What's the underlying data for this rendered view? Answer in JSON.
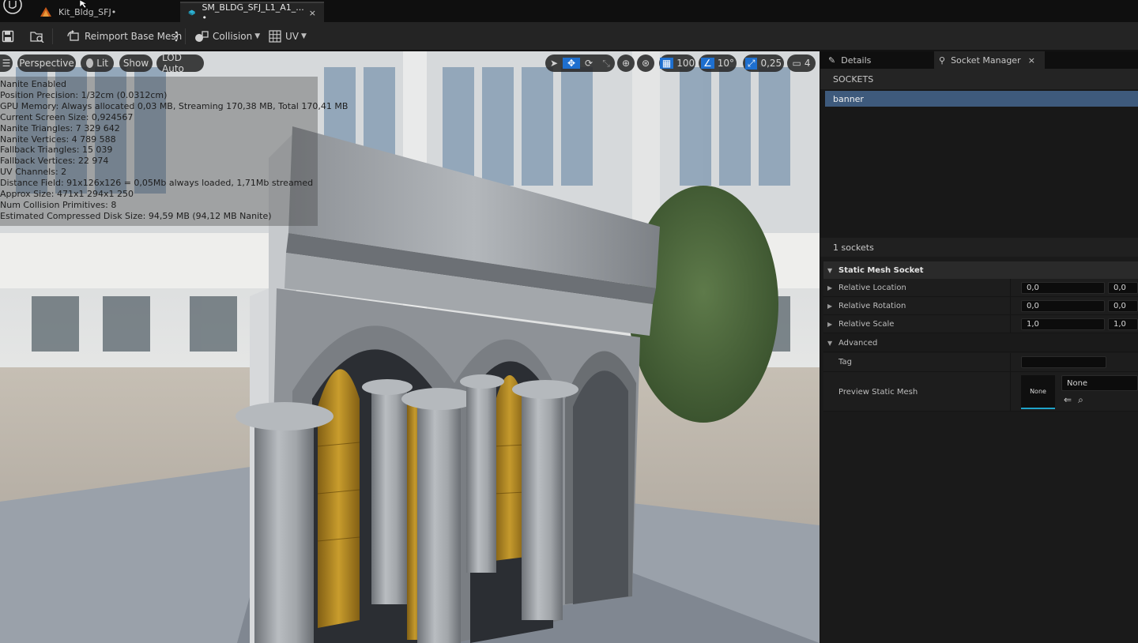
{
  "tabs": [
    {
      "label": "Kit_Bldg_SFJ•",
      "icon": "level-icon"
    },
    {
      "label": "SM_BLDG_SFJ_L1_A1_... •",
      "icon": "static-mesh-icon",
      "close": "×"
    }
  ],
  "toolbar": {
    "reimport_label": "Reimport Base Mesh",
    "collision_label": "Collision",
    "uv_label": "UV"
  },
  "viewport": {
    "perspective": "Perspective",
    "lit": "Lit",
    "show": "Show",
    "lod": "LOD Auto",
    "grid_snap": "100",
    "rotation_snap": "10°",
    "scale_snap": "0,25",
    "camera_speed": "4"
  },
  "stats": [
    "Nanite Enabled",
    "Position Precision: 1/32cm (0.0312cm)",
    "GPU Memory: Always allocated 0,03 MB, Streaming 170,38 MB, Total 170,41 MB",
    "Current Screen Size:  0,924567",
    "Nanite Triangles:  7 329 642",
    "Nanite Vertices:  4 789 588",
    "Fallback Triangles:  15 039",
    "Fallback Vertices:  22 974",
    "UV Channels:  2",
    "Distance Field:  91x126x126 = 0,05Mb always loaded, 1,71Mb streamed",
    "Approx Size: 471x1 294x1 250",
    "Num Collision Primitives:  8",
    "Estimated Compressed Disk Size: 94,59 MB (94,12 MB Nanite)"
  ],
  "panel": {
    "details_tab": "Details",
    "socket_tab": "Socket Manager",
    "close": "×",
    "sockets_header": "SOCKETS",
    "sockets": [
      "banner"
    ],
    "socket_count": "1 sockets",
    "section_title": "Static Mesh Socket",
    "props": {
      "relative_location": {
        "label": "Relative Location",
        "x": "0,0",
        "y": "0,0"
      },
      "relative_rotation": {
        "label": "Relative Rotation",
        "x": "0,0",
        "y": "0,0"
      },
      "relative_scale": {
        "label": "Relative Scale",
        "x": "1,0",
        "y": "1,0"
      },
      "advanced": {
        "label": "Advanced"
      },
      "tag": {
        "label": "Tag",
        "value": ""
      },
      "preview_mesh": {
        "label": "Preview Static Mesh",
        "thumb": "None",
        "value": "None"
      }
    }
  },
  "colors": {
    "selection": "#3e5a7c",
    "accent_blue": "#1e6fcf",
    "thumb_underline": "#1fa3c9",
    "gold": "#c9961e"
  }
}
